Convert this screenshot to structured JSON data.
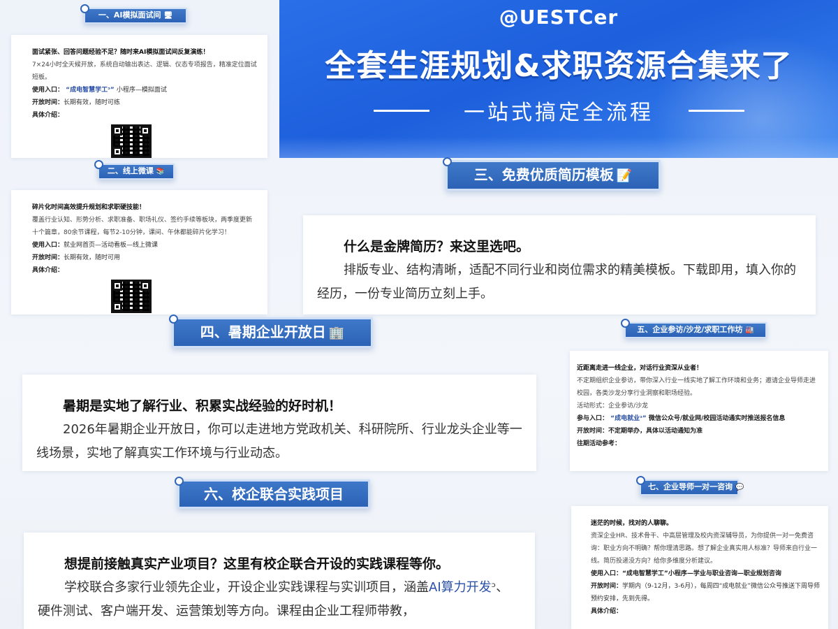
{
  "banner": {
    "handle": "@UESTCer",
    "title": "全套生涯规划&求职资源合集来了",
    "subtitle": "一站式搞定全流程"
  },
  "sections": {
    "s1": {
      "title": "一、AI模拟面试间",
      "emoji": "🖥",
      "headline": "面试紧张、回答问题经验不足？随时来AI模拟面试间反复演练！",
      "body": "7×24小时全天候开放，系统自动输出表达、逻辑、仪态专项报告，精准定位面试短板。",
      "entry_label": "使用入口：",
      "entry_link": "“成电智慧学工ᵓ”",
      "entry_rest": "小程序—模拟面试",
      "time_label": "开放时间：",
      "time_value": "长期有效，随时可练",
      "intro_label": "具体介绍："
    },
    "s2": {
      "title": "二、线上微课",
      "emoji": "📚",
      "headline": "碎片化时间高效提升规划和求职硬技能！",
      "body": "覆盖行业认知、形势分析、求职准备、职场礼仪、签约手续等板块，两季度更新十个篇章，80余节课程，每节2-10分钟，课间、午休都能碎片化学习！",
      "entry_label": "使用入口：",
      "entry_rest": "就业网首页—活动看板—线上微课",
      "time_label": "开放时间：",
      "time_value": "长期有效，随时可用",
      "intro_label": "具体介绍："
    },
    "s3": {
      "title": "三、免费优质简历模板",
      "emoji": "📝",
      "headline": "什么是金牌简历？来这里选吧。",
      "body": "排版专业、结构清晰，适配不同行业和岗位需求的精美模板。下载即用，填入你的经历，一份专业简历立刻上手。"
    },
    "s4": {
      "title": "四、暑期企业开放日",
      "emoji": "🏢",
      "headline": "暑期是实地了解行业、积累实战经验的好时机！",
      "body": "2026年暑期企业开放日，你可以走进地方党政机关、科研院所、行业龙头企业等一线场景，实地了解真实工作环境与行业动态。"
    },
    "s5": {
      "title": "五、企业参访/沙龙/求职工作坊",
      "emoji": "🏭",
      "headline": "近距离走进一线企业，对话行业资深从业者！",
      "body": "不定期组织企业参访，带你深入行业一线实地了解工作环境和业务；邀请企业导师走进校园，各类沙龙分享行业洞察和职场经验。",
      "form_label": "活动形式：",
      "form_value": "企业参访/沙龙",
      "entry_label": "参与入口：",
      "entry_link": "“成电就业ᵓ”",
      "entry_rest": "微信公众号/就业网/校园活动通实时推送报名信息",
      "time_label": "开放时间：",
      "time_value": "不定期举办，具体以活动通知为准",
      "past_label": "往期活动参考："
    },
    "s6": {
      "title": "六、校企联合实践项目",
      "headline": "想提前接触真实产业项目？这里有校企联合开设的实践课程等你。",
      "body_pre": "学校联合多家行业领先企业，开设企业实践课程与实训项目，涵盖",
      "body_link": "AI算力开发",
      "body_post": "ᵓ、硬件测试、客户端开发、运营策划等方向。课程由企业工程师带教，"
    },
    "s7": {
      "title": "七、企业导师一对一咨询",
      "emoji": "💬",
      "headline": "迷茫的时候，找对的人聊聊。",
      "body": "资深企业HR、技术骨干、中高层管理及校内资深辅导员，为你提供一对一免费咨询：职业方向不明确？帮你理清思路。想了解企业真实用人标准？导师来自行业一线。简历投递没方向？给你多维度分析建议。",
      "entry_label": "使用入口：",
      "entry_value": "“成电智慧学工”小程序—学业与职业咨询—职业规划咨询",
      "time_label": "开放时间：",
      "time_value": "学期内（9-12月，3-6月），每周四“成电就业”微信公众号推送下周导师预约安排，先到先得。",
      "intro_label": "具体介绍："
    }
  }
}
